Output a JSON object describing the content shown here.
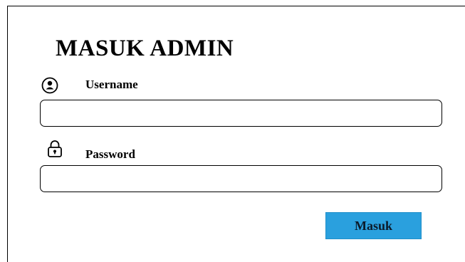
{
  "login": {
    "title": "MASUK ADMIN",
    "username_label": "Username",
    "username_icon": "user-circle-icon",
    "username_value": "",
    "password_label": "Password",
    "password_icon": "lock-icon",
    "password_value": "",
    "submit_label": "Masuk",
    "accent_color": "#2aa0de"
  }
}
